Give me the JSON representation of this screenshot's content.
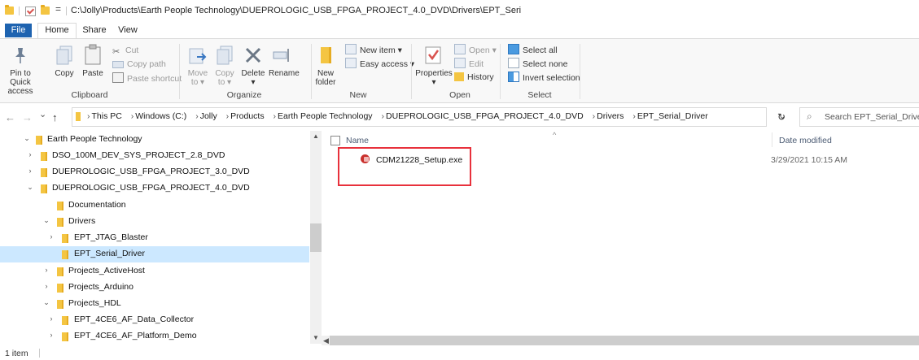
{
  "window": {
    "title_path": "C:\\Jolly\\Products\\Earth People Technology\\DUEPROLOGIC_USB_FPGA_PROJECT_4.0_DVD\\Drivers\\EPT_Seri",
    "qat_dropdown": "="
  },
  "tabs": {
    "file": "File",
    "home": "Home",
    "share": "Share",
    "view": "View"
  },
  "ribbon": {
    "clipboard": {
      "pin": "Pin to Quick access",
      "copy": "Copy",
      "paste": "Paste",
      "cut": "Cut",
      "copy_path": "Copy path",
      "paste_shortcut": "Paste shortcut",
      "label": "Clipboard"
    },
    "organize": {
      "move_to": "Move to ▾",
      "copy_to": "Copy to ▾",
      "delete": "Delete ▾",
      "rename": "Rename",
      "label": "Organize"
    },
    "new": {
      "new_folder": "New folder",
      "new_item": "New item ▾",
      "easy_access": "Easy access ▾",
      "label": "New"
    },
    "open": {
      "properties": "Properties ▾",
      "open": "Open ▾",
      "edit": "Edit",
      "history": "History",
      "label": "Open"
    },
    "select": {
      "select_all": "Select all",
      "select_none": "Select none",
      "invert": "Invert selection",
      "label": "Select"
    }
  },
  "address": {
    "back": "←",
    "forward": "→",
    "recent": "⌄",
    "up": "↑",
    "crumbs": [
      "This PC",
      "Windows (C:)",
      "Jolly",
      "Products",
      "Earth People Technology",
      "DUEPROLOGIC_USB_FPGA_PROJECT_4.0_DVD",
      "Drivers",
      "EPT_Serial_Driver"
    ],
    "search_placeholder": "Search EPT_Serial_Driver"
  },
  "nav_tree": [
    {
      "label": "Earth People Technology",
      "chevron": "⌄"
    },
    {
      "label": "DSO_100M_DEV_SYS_PROJECT_2.8_DVD",
      "chevron": "›"
    },
    {
      "label": "DUEPROLOGIC_USB_FPGA_PROJECT_3.0_DVD",
      "chevron": "›"
    },
    {
      "label": "DUEPROLOGIC_USB_FPGA_PROJECT_4.0_DVD",
      "chevron": "⌄"
    },
    {
      "label": "Documentation",
      "chevron": ""
    },
    {
      "label": "Drivers",
      "chevron": "⌄"
    },
    {
      "label": "EPT_JTAG_Blaster",
      "chevron": "›"
    },
    {
      "label": "EPT_Serial_Driver",
      "chevron": ""
    },
    {
      "label": "Projects_ActiveHost",
      "chevron": "›"
    },
    {
      "label": "Projects_Arduino",
      "chevron": "›"
    },
    {
      "label": "Projects_HDL",
      "chevron": "⌄"
    },
    {
      "label": "EPT_4CE6_AF_Data_Collector",
      "chevron": "›"
    },
    {
      "label": "EPT_4CE6_AF_Platform_Demo",
      "chevron": "›"
    }
  ],
  "columns": {
    "name": "Name",
    "date": "Date modified"
  },
  "files": [
    {
      "name": "CDM21228_Setup.exe",
      "date": "3/29/2021 10:15 AM"
    }
  ],
  "status": {
    "count": "1 item"
  },
  "colors": {
    "file_tab": "#1e63b0",
    "selected": "#cce8ff",
    "highlight": "#e8313c",
    "folder": "#f4c542"
  }
}
